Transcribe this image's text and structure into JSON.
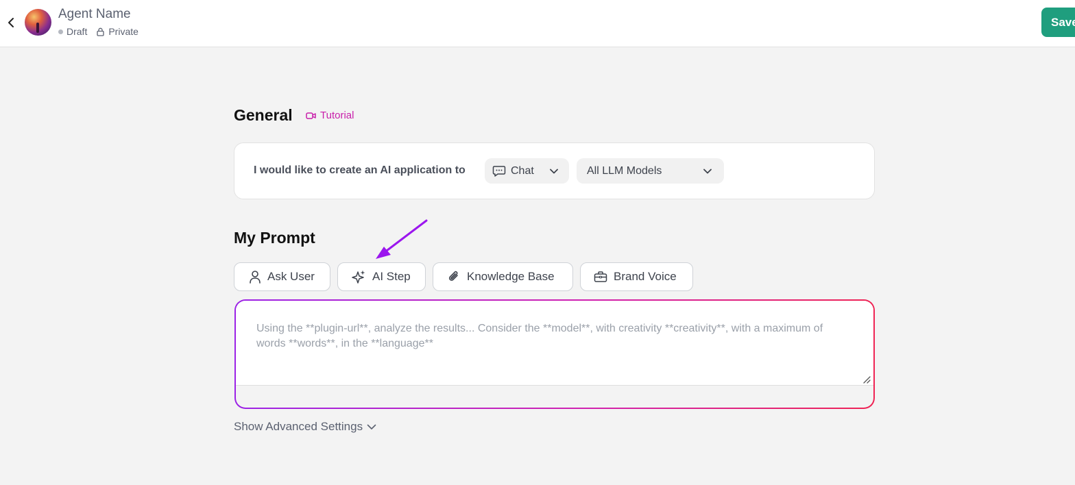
{
  "header": {
    "agent_name": "Agent Name",
    "status": "Draft",
    "visibility": "Private",
    "save_label": "Save"
  },
  "general": {
    "title": "General",
    "tutorial_label": "Tutorial",
    "create_text": "I would like to create an AI application to",
    "app_type": "Chat",
    "model": "All LLM Models"
  },
  "prompt": {
    "title": "My Prompt",
    "chips": [
      "Ask User",
      "AI Step",
      "Knowledge Base",
      "Brand Voice"
    ],
    "placeholder": "Using the **plugin-url**, analyze the results... Consider the **model**, with creativity **creativity**, with a maximum of words **words**, in the **language**"
  },
  "advanced_label": "Show Advanced Settings",
  "colors": {
    "save": "#1f9e7e",
    "tutorial": "#c81eaa",
    "annotation_arrow": "#9b16ee",
    "prompt_border_start": "#9b22e6",
    "prompt_border_end": "#ef2353"
  },
  "icons": [
    "chevron-left-icon",
    "dot-icon",
    "lock-icon",
    "video-icon",
    "chat-bubble-icon",
    "chevron-down-icon",
    "user-icon",
    "sparkles-icon",
    "paperclip-icon",
    "briefcase-icon",
    "resize-handle-icon",
    "annotation-arrow-icon"
  ]
}
